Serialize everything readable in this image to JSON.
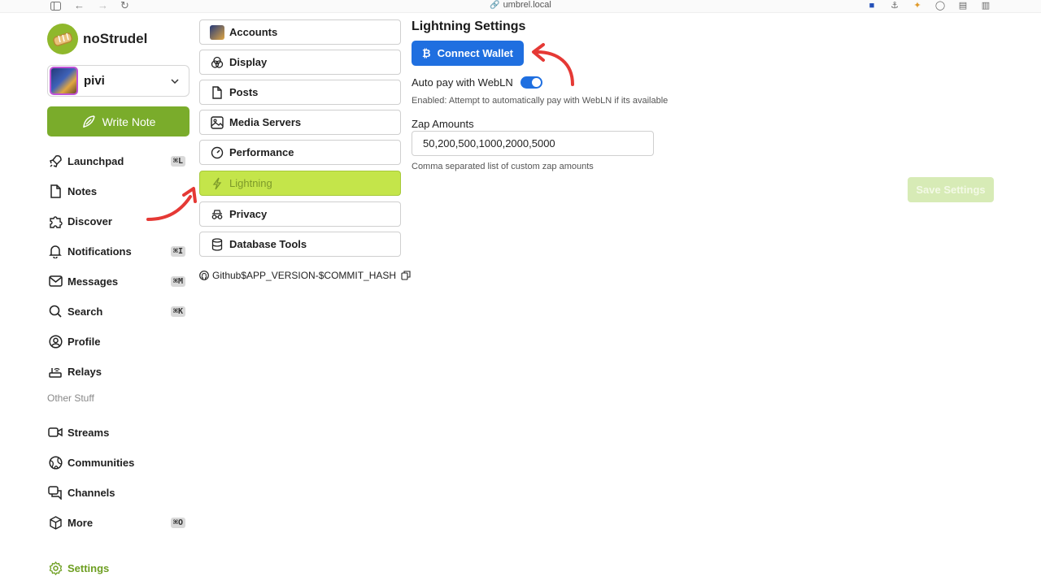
{
  "browser": {
    "url": "umbrel.local"
  },
  "brand": {
    "name": "noStrudel"
  },
  "account": {
    "name": "pivi"
  },
  "write_note": {
    "label": "Write Note"
  },
  "nav": {
    "items": [
      {
        "label": "Launchpad",
        "icon": "rocket-icon",
        "shortcut": "⌘L"
      },
      {
        "label": "Notes",
        "icon": "note-icon",
        "shortcut": ""
      },
      {
        "label": "Discover",
        "icon": "puzzle-icon",
        "shortcut": ""
      },
      {
        "label": "Notifications",
        "icon": "bell-icon",
        "shortcut": "⌘I"
      },
      {
        "label": "Messages",
        "icon": "mail-icon",
        "shortcut": "⌘M"
      },
      {
        "label": "Search",
        "icon": "search-icon",
        "shortcut": "⌘K"
      },
      {
        "label": "Profile",
        "icon": "user-circle-icon",
        "shortcut": ""
      },
      {
        "label": "Relays",
        "icon": "router-icon",
        "shortcut": ""
      }
    ],
    "section_label": "Other Stuff",
    "other_items": [
      {
        "label": "Streams",
        "icon": "video-icon",
        "shortcut": ""
      },
      {
        "label": "Communities",
        "icon": "globe-icon",
        "shortcut": ""
      },
      {
        "label": "Channels",
        "icon": "chat-icon",
        "shortcut": ""
      },
      {
        "label": "More",
        "icon": "cube-icon",
        "shortcut": "⌘O"
      }
    ],
    "settings": {
      "label": "Settings",
      "icon": "gear-icon"
    }
  },
  "settings_menu": {
    "items": [
      {
        "label": "Accounts",
        "icon": "avatar-icon",
        "active": false
      },
      {
        "label": "Display",
        "icon": "circles-icon",
        "active": false
      },
      {
        "label": "Posts",
        "icon": "file-icon",
        "active": false
      },
      {
        "label": "Media Servers",
        "icon": "image-icon",
        "active": false
      },
      {
        "label": "Performance",
        "icon": "gauge-icon",
        "active": false
      },
      {
        "label": "Lightning",
        "icon": "lightning-icon",
        "active": true
      },
      {
        "label": "Privacy",
        "icon": "spy-icon",
        "active": false
      },
      {
        "label": "Database Tools",
        "icon": "database-icon",
        "active": false
      }
    ],
    "github_text": "Github$APP_VERSION-$COMMIT_HASH"
  },
  "lightning": {
    "title": "Lightning Settings",
    "connect_wallet_label": "Connect Wallet",
    "autopay_label": "Auto pay with WebLN",
    "autopay_enabled": true,
    "autopay_help": "Enabled: Attempt to automatically pay with WebLN if its available",
    "zap_amounts_label": "Zap Amounts",
    "zap_amounts_value": "50,200,500,1000,2000,5000",
    "zap_amounts_help": "Comma separated list of custom zap amounts",
    "save_label": "Save Settings"
  },
  "colors": {
    "brand_green": "#7aac2b",
    "active_menu": "#c4e54a",
    "primary_blue": "#1f6fe0",
    "annotation_red": "#e53935"
  }
}
